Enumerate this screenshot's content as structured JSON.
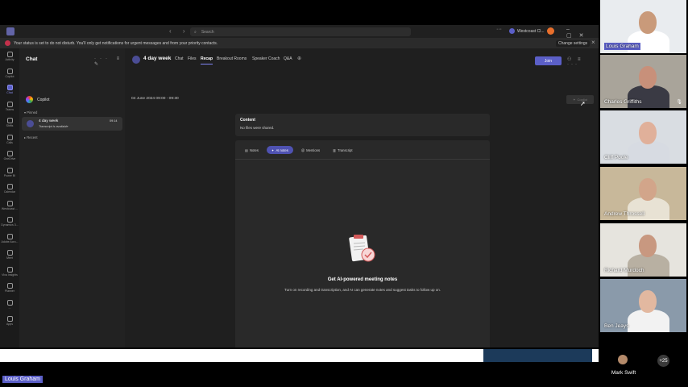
{
  "titlebar": {
    "search_placeholder": "Search",
    "org_name": "Westcoast Cl..."
  },
  "status_banner": {
    "text": "Your status is set to do not disturb. You'll only get notifications for urgent messages and from your priority contacts.",
    "change_settings": "Change settings"
  },
  "rail": {
    "items": [
      {
        "label": "Activity",
        "icon": "bell-icon"
      },
      {
        "label": "Copilot",
        "icon": "copilot-icon"
      },
      {
        "label": "Chat",
        "icon": "chat-icon"
      },
      {
        "label": "Teams",
        "icon": "teams-icon"
      },
      {
        "label": "Shifts",
        "icon": "shifts-icon"
      },
      {
        "label": "Calls",
        "icon": "phone-icon"
      },
      {
        "label": "OneDrive",
        "icon": "cloud-icon"
      },
      {
        "label": "Power BI",
        "icon": "chart-icon"
      },
      {
        "label": "Calendar",
        "icon": "calendar-icon"
      },
      {
        "label": "Westcoast ...",
        "icon": "app-icon"
      },
      {
        "label": "Dynamics 3...",
        "icon": "dynamics-icon"
      },
      {
        "label": "Adobe Acro...",
        "icon": "acrobat-icon"
      },
      {
        "label": "Meet",
        "icon": "video-icon"
      },
      {
        "label": "Viva Insights",
        "icon": "insights-icon"
      },
      {
        "label": "Planner",
        "icon": "planner-icon"
      },
      {
        "label": "...",
        "icon": "more-icon"
      },
      {
        "label": "Apps",
        "icon": "apps-icon"
      }
    ]
  },
  "chat_panel": {
    "title": "Chat",
    "copilot": "Copilot",
    "pinned": "Pinned",
    "recent": "Recent",
    "chat_item": {
      "name": "4 day week",
      "subtitle": "Transcript is available",
      "time": "09:14"
    }
  },
  "meeting": {
    "title": "4 day week",
    "tabs": [
      "Chat",
      "Files",
      "Recap",
      "Breakout Rooms",
      "Speaker Coach",
      "Q&A"
    ],
    "active_tab": "Recap",
    "join": "Join",
    "datetime": "04 June 2024 09:00 - 09:30",
    "copilot_button": "Copilot",
    "content_heading": "Content",
    "content_value": "No files were shared.",
    "note_tabs": [
      "Notes",
      "AI notes",
      "Mentions",
      "Transcript"
    ],
    "active_note_tab": "AI notes",
    "empty_title": "Get AI-powered meeting notes",
    "empty_desc": "Turn on recording and transcription, and AI can generate notes and suggest tasks to follow up on."
  },
  "presenter_name": "Louis Graham",
  "participants": [
    {
      "name": "Louis Graham",
      "highlight": true,
      "bg": "#e9ecef",
      "skin": "#c99a7a",
      "shirt": "#ffffff"
    },
    {
      "name": "Charles Griffiths",
      "highlight": false,
      "bg": "#a9a49a",
      "skin": "#c8907a",
      "shirt": "#3a3a44"
    },
    {
      "name": "Cliff Poole",
      "highlight": false,
      "bg": "#d9dde2",
      "skin": "#e0b09a",
      "shirt": "#d7dbe2"
    },
    {
      "name": "Andrew Throssell",
      "highlight": false,
      "bg": "#c8b89a",
      "skin": "#d2a58a",
      "shirt": "#e8e2d4"
    },
    {
      "name": "Richard Murdoch",
      "highlight": false,
      "bg": "#e6e4de",
      "skin": "#c89880",
      "shirt": "#b8b0a2"
    },
    {
      "name": "Ben Jeays",
      "highlight": false,
      "bg": "#8a9aaa",
      "skin": "#e2b8a0",
      "shirt": "#f2f2f2"
    }
  ],
  "overflow": {
    "name": "Mark Swift",
    "more_count": "+25"
  }
}
